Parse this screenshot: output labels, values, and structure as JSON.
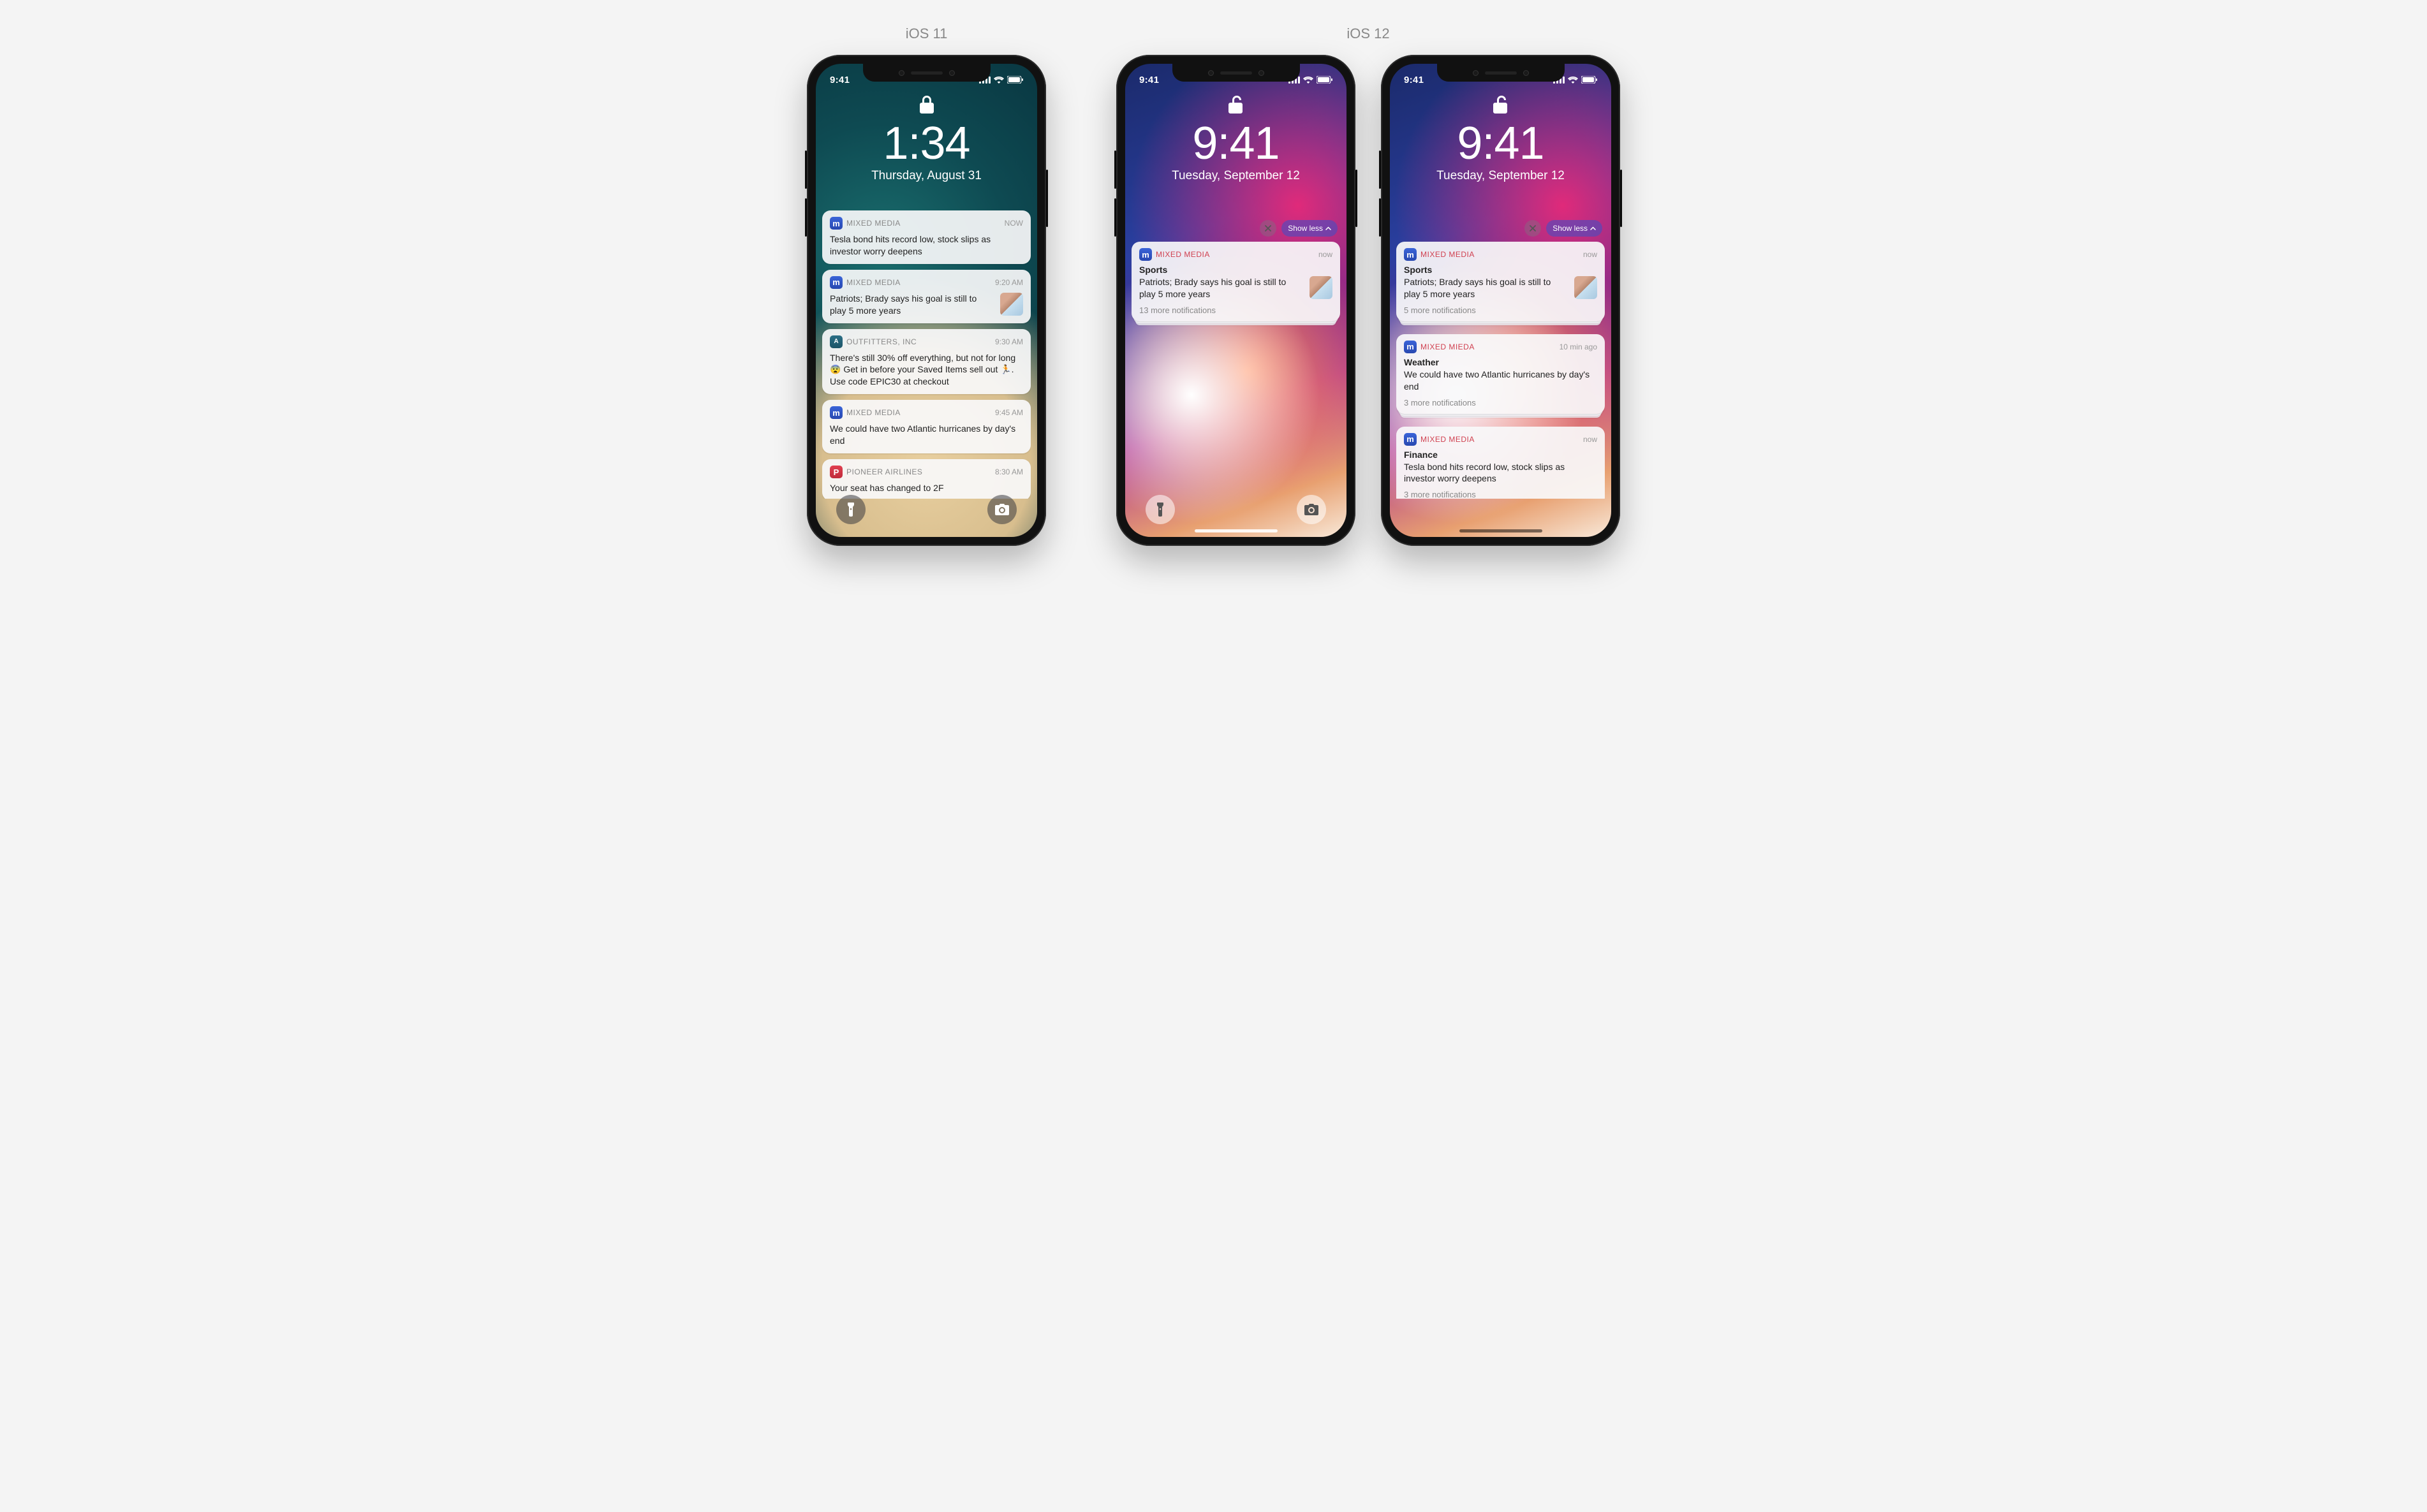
{
  "labels": {
    "ios11": "iOS 11",
    "ios12": "iOS 12"
  },
  "show_less": "Show less",
  "phone11": {
    "status_time": "9:41",
    "time": "1:34",
    "date": "Thursday, August 31",
    "notifs": [
      {
        "app": "MIXED MEDIA",
        "icon": "mm",
        "time": "NOW",
        "body": "Tesla bond hits record low, stock slips as investor worry deepens"
      },
      {
        "app": "MIXED MEDIA",
        "icon": "mm",
        "time": "9:20 AM",
        "body": "Patriots; Brady says his goal is still to play 5 more years",
        "thumb": true
      },
      {
        "app": "OUTFITTERS, INC",
        "icon": "out",
        "time": "9:30 AM",
        "body": "There's still 30% off everything, but not for long 😨 Get in before your Saved Items sell out 🏃. Use code EPIC30 at checkout"
      },
      {
        "app": "MIXED MEDIA",
        "icon": "mm",
        "time": "9:45 AM",
        "body": "We could have two Atlantic hurricanes by day's end"
      },
      {
        "app": "PIONEER AIRLINES",
        "icon": "pa",
        "time": "8:30 AM",
        "body": "Your seat has changed to 2F"
      }
    ]
  },
  "phone12a": {
    "status_time": "9:41",
    "time": "9:41",
    "date": "Tuesday, September 12",
    "group": {
      "app": "MIXED MEDIA",
      "time": "now",
      "title": "Sports",
      "body": "Patriots; Brady says his goal is still to play 5 more years",
      "thumb": true,
      "more": "13 more notifications"
    }
  },
  "phone12b": {
    "status_time": "9:41",
    "time": "9:41",
    "date": "Tuesday, September 12",
    "groups": [
      {
        "app": "MIXED MEDIA",
        "time": "now",
        "title": "Sports",
        "body": "Patriots; Brady says his goal is still to play 5 more years",
        "thumb": true,
        "more": "5 more notifications"
      },
      {
        "app": "MIXED MIEDA",
        "time": "10 min ago",
        "title": "Weather",
        "body": "We could have two Atlantic hurricanes by day's end",
        "more": "3 more notifications"
      },
      {
        "app": "MIXED MEDIA",
        "time": "now",
        "title": "Finance",
        "body": "Tesla bond hits record low, stock slips as investor worry deepens",
        "more": "3 more notifications"
      }
    ]
  }
}
